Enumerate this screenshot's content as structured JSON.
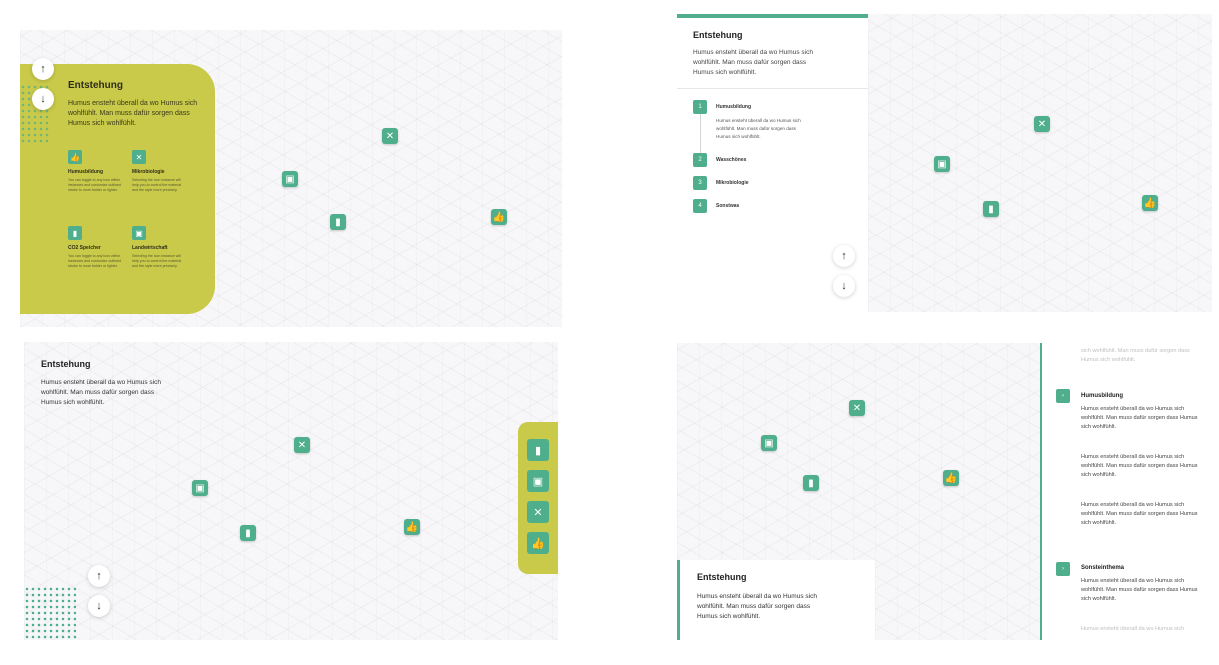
{
  "colors": {
    "accent": "#4fae8c",
    "olive": "#c9c94a"
  },
  "common": {
    "title": "Entstehung",
    "intro": "Humus ensteht überall da wo Humus sich wohlfühlt. Man muss dafür sorgen dass Humus sich wohlfühlt.",
    "up_icon": "↑",
    "down_icon": "↓"
  },
  "panel1": {
    "features": [
      {
        "icon": "thumbs-up-icon",
        "glyph": "👍",
        "title": "Humusbildung",
        "text": "You can toggle to any icon within instances and customize outlined stroke to more bolder or lighter."
      },
      {
        "icon": "microbe-icon",
        "glyph": "✕",
        "title": "Mikrobiologie",
        "text": "Selecting the icon instance will help you to control the material and the style more precisely."
      },
      {
        "icon": "chart-icon",
        "glyph": "▮",
        "title": "CO2 Speicher",
        "text": "You can toggle to any icon within instances and customize outlined stroke to more bolder or lighter."
      },
      {
        "icon": "farm-icon",
        "glyph": "▣",
        "title": "Landwirtschaft",
        "text": "Selecting the icon instance will help you to control the material and the style more precisely."
      }
    ]
  },
  "panel2": {
    "steps": [
      {
        "num": "1",
        "label": "Humusbildung"
      },
      {
        "num": "2",
        "label": "Wasschönes"
      },
      {
        "num": "3",
        "label": "Mikrobiologie"
      },
      {
        "num": "4",
        "label": "Sonstwas"
      }
    ],
    "step1_text": "Humus ensteht überall da wo Humus sich wohlfühlt. Man muss dafür sorgen dass Humus sich wohlfühlt."
  },
  "panel3": {
    "sidebar": [
      {
        "icon": "chart-icon",
        "glyph": "▮"
      },
      {
        "icon": "farm-icon",
        "glyph": "▣"
      },
      {
        "icon": "microbe-icon",
        "glyph": "✕"
      },
      {
        "icon": "thumbs-up-icon",
        "glyph": "👍"
      }
    ]
  },
  "panel4": {
    "faded_top": "sich wohlfühlt. Man muss dafür sorgen dass Humus sich wohlfühlt.",
    "section1_title": "Humusbildung",
    "section1_text": "Humus ensteht überall da wo Humus sich wohlfühlt. Man muss dafür sorgen dass Humus sich wohlfühlt.",
    "section2_title": "Sonsteinthema",
    "section2_text": "Humus ensteht überall da wo Humus sich wohlfühlt. Man muss dafür sorgen dass Humus sich wohlfühlt.",
    "faded_bottom": "Humus ensteht überall da wo Humus sich",
    "chevron": "›"
  }
}
